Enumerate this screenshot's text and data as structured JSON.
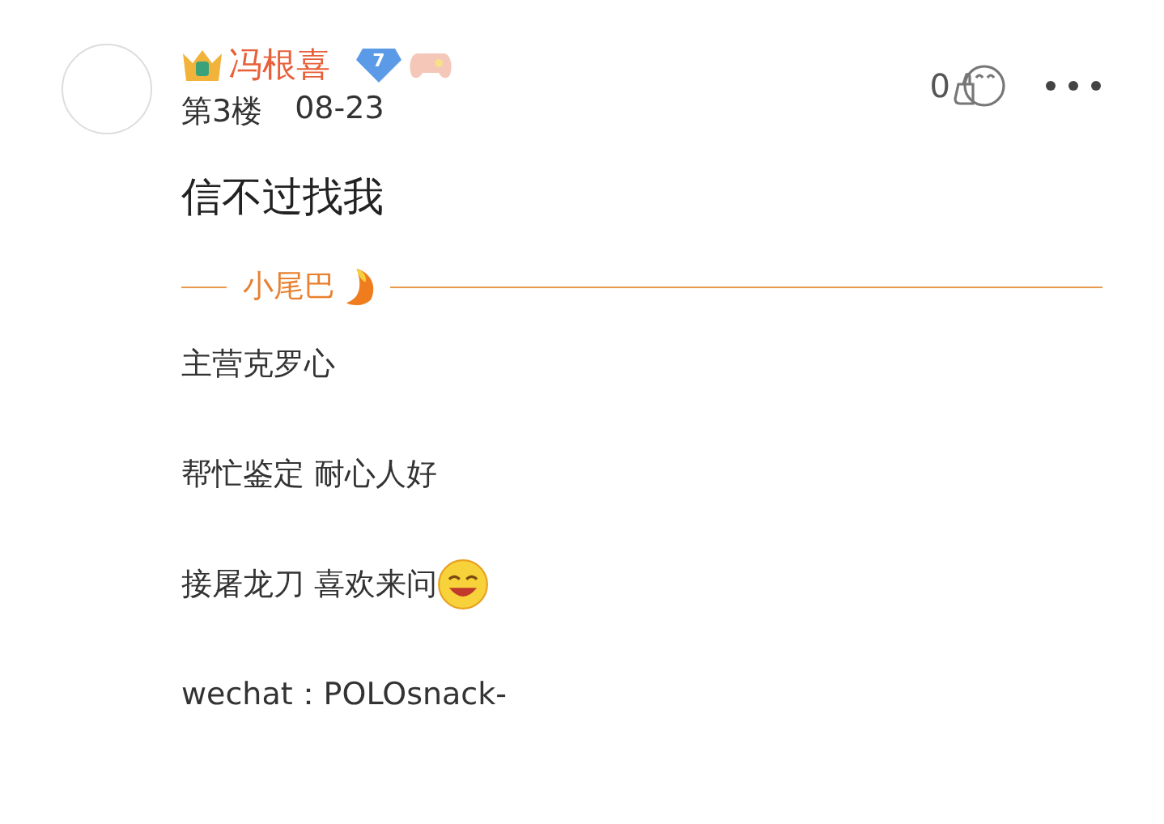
{
  "post": {
    "username": "冯根喜",
    "level_badge": "7",
    "floor": "第3楼",
    "date": "08-23",
    "like_count": "0",
    "content": "信不过找我"
  },
  "signature": {
    "title": "小尾巴",
    "lines": [
      [
        {
          "kind": "text",
          "text": "主营克罗心"
        }
      ],
      [
        {
          "kind": "text",
          "text": "帮忙鉴定 耐心人好"
        }
      ],
      [
        {
          "kind": "text",
          "text": "接屠龙刀 喜欢来问"
        },
        {
          "kind": "emoji"
        }
      ],
      [
        {
          "kind": "text",
          "text": "wechat：POLOsnack-"
        }
      ]
    ]
  }
}
